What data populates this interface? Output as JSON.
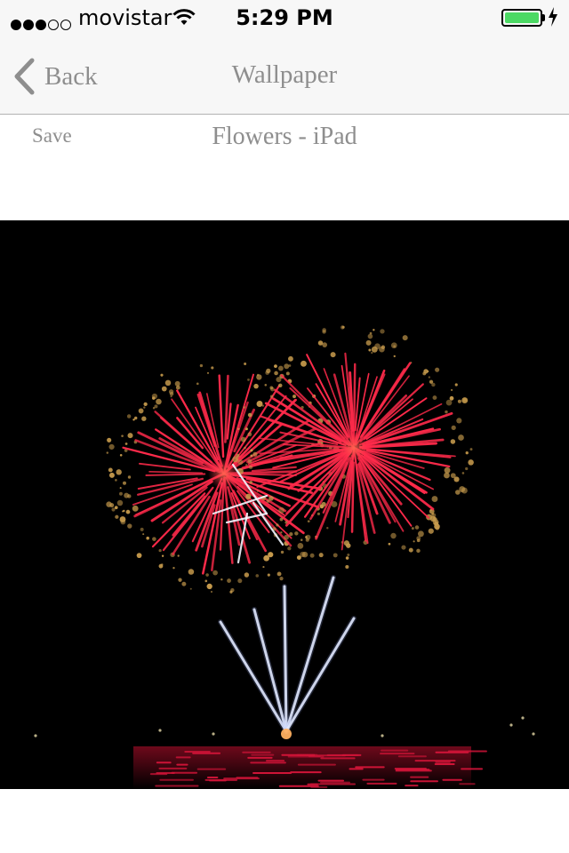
{
  "status_bar": {
    "signal_bars_filled": 3,
    "signal_bars_total": 5,
    "carrier": "movistar",
    "time": "5:29 PM",
    "battery_level": 1.0,
    "battery_color": "#4cd964",
    "charging": true
  },
  "nav": {
    "back_label": "Back",
    "title": "Wallpaper"
  },
  "content": {
    "save_label": "Save",
    "wallpaper_title": "Flowers - iPad"
  },
  "image": {
    "subject": "fireworks",
    "colors": {
      "burst": "#ff2a4a",
      "white": "#f2f6ff",
      "gold": "#c69a4c",
      "water": "#d11438"
    }
  },
  "colors": {
    "nav_text": "#8e8e8e",
    "bar_background": "#f7f7f7"
  }
}
